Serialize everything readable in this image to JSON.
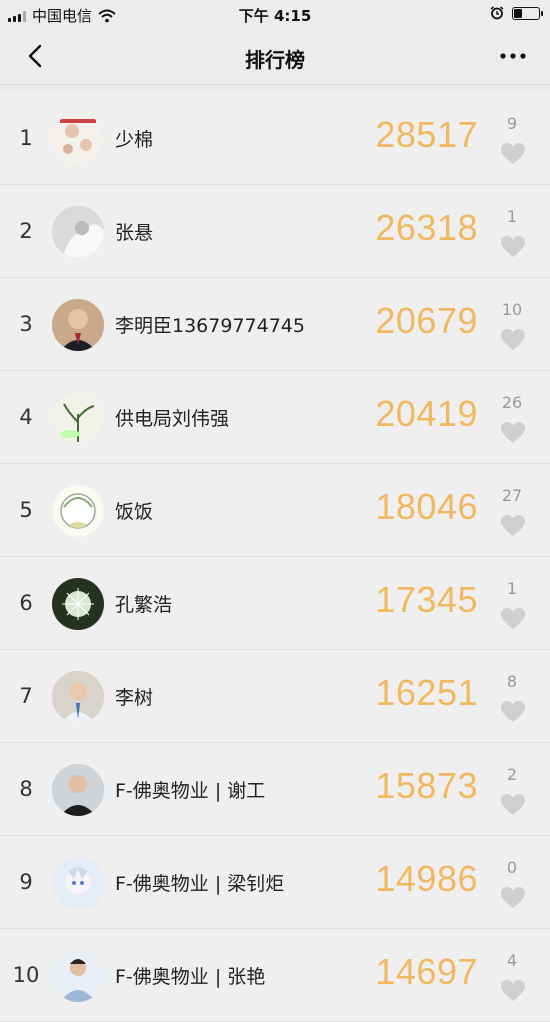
{
  "status_bar": {
    "carrier": "中国电信",
    "time": "下午 4:15",
    "battery_level": 0.35
  },
  "nav": {
    "title": "排行榜",
    "back_icon": "chevron-left-icon",
    "more_icon": "more-dots-icon"
  },
  "rows": [
    {
      "rank": "1",
      "name": "少棉",
      "score": "28517",
      "likes": "9"
    },
    {
      "rank": "2",
      "name": "张悬",
      "score": "26318",
      "likes": "1"
    },
    {
      "rank": "3",
      "name": "李明臣13679774745",
      "score": "20679",
      "likes": "10"
    },
    {
      "rank": "4",
      "name": "供电局刘伟强",
      "score": "20419",
      "likes": "26"
    },
    {
      "rank": "5",
      "name": "饭饭",
      "score": "18046",
      "likes": "27"
    },
    {
      "rank": "6",
      "name": "孔繁浩",
      "score": "17345",
      "likes": "1"
    },
    {
      "rank": "7",
      "name": "李树",
      "score": "16251",
      "likes": "8"
    },
    {
      "rank": "8",
      "name": "F-佛奥物业 | 谢工",
      "score": "15873",
      "likes": "2"
    },
    {
      "rank": "9",
      "name": "F-佛奥物业 | 梁钊炬",
      "score": "14986",
      "likes": "0"
    },
    {
      "rank": "10",
      "name": "F-佛奥物业 | 张艳",
      "score": "14697",
      "likes": "4"
    }
  ],
  "colors": {
    "score": "#f2b860",
    "heart": "#cfcfcf",
    "background": "#ebebeb"
  }
}
